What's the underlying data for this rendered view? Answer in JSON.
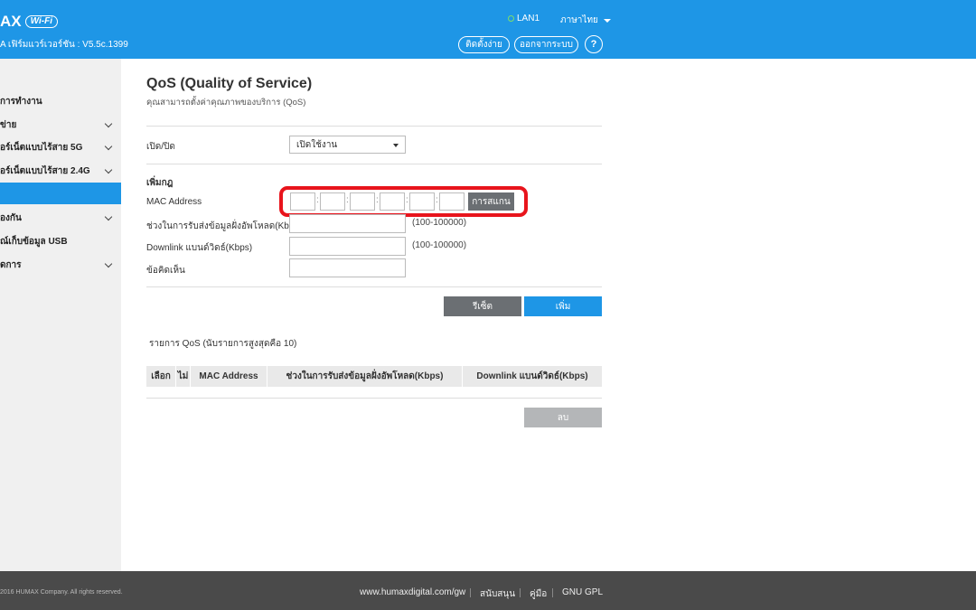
{
  "header": {
    "logo_text": "AX",
    "logo_badge": "Wi-Fi",
    "firmware": "A เฟิร์มแวร์เวอร์ชัน : V5.5c.1399",
    "lan_label": "LAN1",
    "language": "ภาษาไทย",
    "easy_setup": "ติดตั้งง่าย",
    "logout": "ออกจากระบบ",
    "help": "?"
  },
  "sidebar": {
    "items": [
      {
        "label": "การทำงาน",
        "chevron": false
      },
      {
        "label": "ข่าย",
        "chevron": true
      },
      {
        "label": "อร์เน็ตแบบไร้สาย 5G",
        "chevron": true
      },
      {
        "label": "อร์เน็ตแบบไร้สาย 2.4G",
        "chevron": true
      },
      {
        "label": "",
        "chevron": false,
        "active": true
      },
      {
        "label": "องกัน",
        "chevron": true
      },
      {
        "label": "ณ์เก็บข้อมูล USB",
        "chevron": false
      },
      {
        "label": "ดการ",
        "chevron": true
      }
    ]
  },
  "main": {
    "title": "QoS (Quality of Service)",
    "subtitle": "คุณสามารถตั้งค่าคุณภาพของบริการ (QoS)",
    "enable_label": "เปิด/ปิด",
    "enable_value": "เปิดใช้งาน",
    "add_rule_heading": "เพิ่มกฎ",
    "mac_label": "MAC Address",
    "scan_button": "การสแกน",
    "upload_label": "ช่วงในการรับส่งข้อมูลฝั่งอัพโหลด(Kbps)",
    "upload_range": "(100-100000)",
    "downlink_label": "Downlink แบนด์วิดธ์(Kbps)",
    "downlink_range": "(100-100000)",
    "comment_label": "ข้อคิดเห็น",
    "reset_button": "รีเซ็ต",
    "add_button": "เพิ่ม",
    "list_caption": "รายการ QoS  (นับรายการสูงสุดคือ 10)",
    "table_headers": [
      "เลือก",
      "ไม่",
      "MAC Address",
      "ช่วงในการรับส่งข้อมูลฝั่งอัพโหลด(Kbps)",
      "Downlink แบนด์วิดธ์(Kbps)"
    ],
    "delete_button": "ลบ"
  },
  "footer": {
    "copyright": "2016 HUMAX Company. All rights reserved.",
    "links": [
      "www.humaxdigital.com/gw",
      "สนับสนุน",
      "คู่มือ",
      "GNU GPL"
    ]
  },
  "colors": {
    "header_blue": "#1e96e6",
    "button_blue": "#1e96e6",
    "button_gray": "#6b6f73",
    "disabled_gray": "#b4b6b8",
    "highlight_red": "#e8141c",
    "footer_bg": "#4a4a4a"
  }
}
